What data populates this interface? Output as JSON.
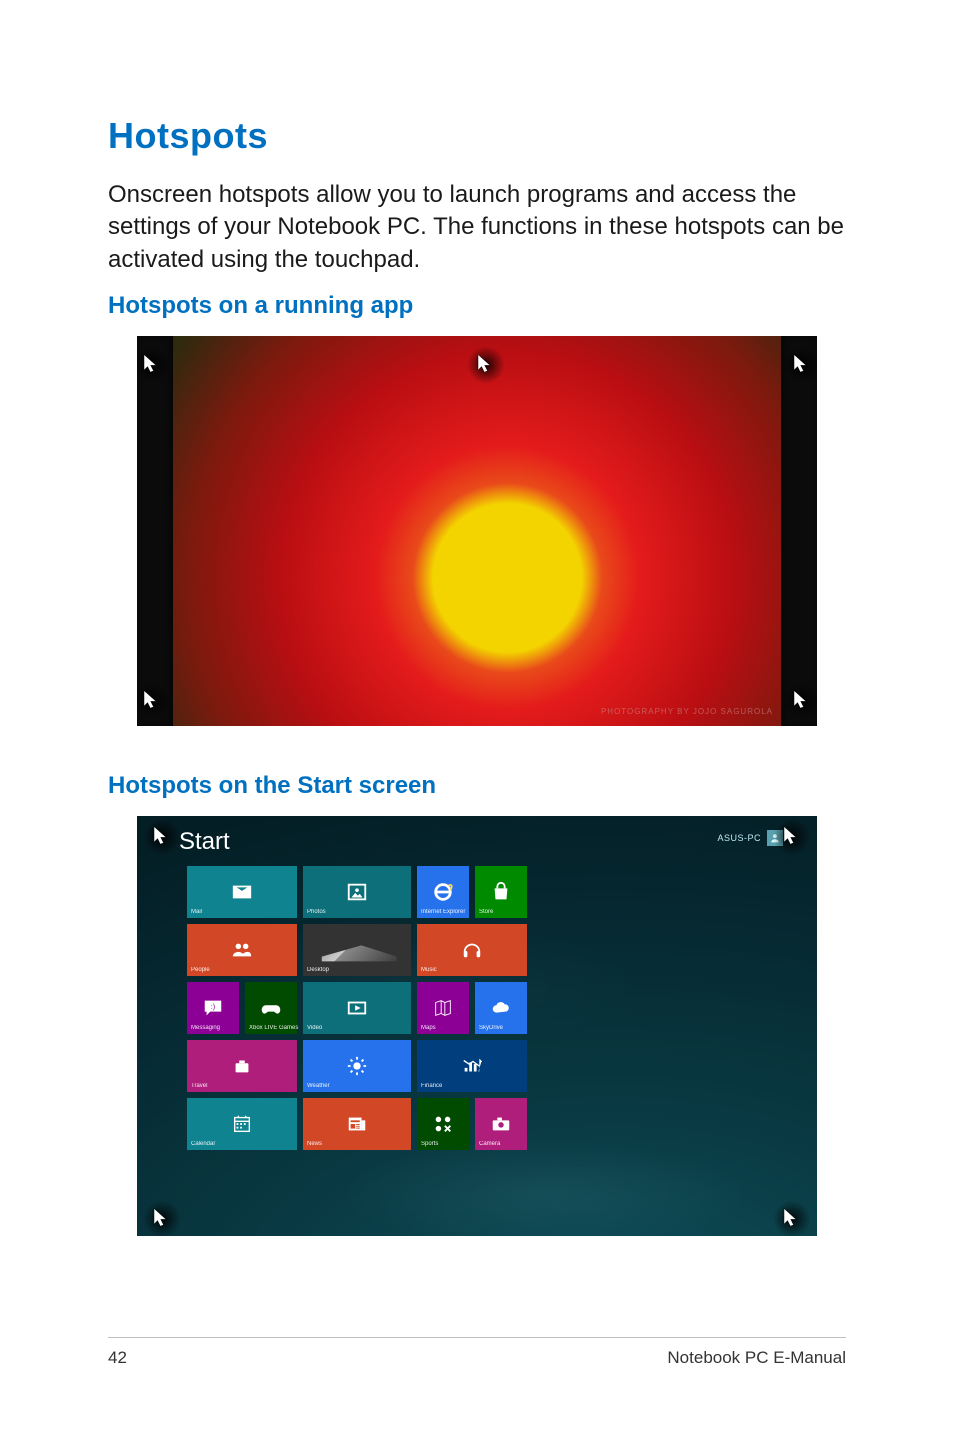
{
  "page": {
    "number": "42",
    "footer": "Notebook PC E-Manual"
  },
  "headings": {
    "title": "Hotspots",
    "sub_running": "Hotspots on a running app",
    "sub_start": "Hotspots on the Start screen"
  },
  "body": {
    "intro": "Onscreen hotspots allow you to launch programs and access the settings of your Notebook PC. The functions in these hotspots can be activated using the touchpad."
  },
  "running_app": {
    "photo_credit": "Photography by Jojo Sagurola"
  },
  "start_screen": {
    "title": "Start",
    "user": "ASUS-PC",
    "tiles": [
      {
        "id": "mail",
        "label": "Mail",
        "icon": "mail",
        "color": "c-teal",
        "wide": true
      },
      {
        "id": "photos",
        "label": "Photos",
        "icon": "photo",
        "color": "c-teal2",
        "wide": false,
        "col": 3
      },
      {
        "id": "ie",
        "label": "Internet Explorer",
        "icon": "ie",
        "color": "c-blue",
        "wide": false
      },
      {
        "id": "store",
        "label": "Store",
        "icon": "store",
        "color": "c-green",
        "wide": false
      },
      {
        "id": "people",
        "label": "People",
        "icon": "people",
        "color": "c-orange",
        "wide": true
      },
      {
        "id": "desktop",
        "label": "Desktop",
        "icon": "desktop",
        "color": "c-gray",
        "wide": false,
        "col": 3
      },
      {
        "id": "music",
        "label": "Music",
        "icon": "music",
        "color": "c-orange",
        "wide": true,
        "colstart": 4
      },
      {
        "id": "msg",
        "label": "Messaging",
        "icon": "chat",
        "color": "c-purple",
        "wide": false
      },
      {
        "id": "games",
        "label": "Xbox LIVE Games",
        "icon": "games",
        "color": "c-dgreen",
        "wide": false
      },
      {
        "id": "video",
        "label": "Video",
        "icon": "video",
        "color": "c-teal2",
        "wide": false,
        "col": 3
      },
      {
        "id": "maps",
        "label": "Maps",
        "icon": "maps",
        "color": "c-purple",
        "wide": false
      },
      {
        "id": "skydrive",
        "label": "SkyDrive",
        "icon": "cloud",
        "color": "c-blue",
        "wide": false
      },
      {
        "id": "travel",
        "label": "Travel",
        "icon": "travel",
        "color": "c-magenta",
        "wide": true
      },
      {
        "id": "weather",
        "label": "Weather",
        "icon": "weather",
        "color": "c-blue",
        "wide": false,
        "col": 3
      },
      {
        "id": "finance",
        "label": "Finance",
        "icon": "finance",
        "color": "c-dblue",
        "wide": true,
        "colstart": 4
      },
      {
        "id": "calendar",
        "label": "Calendar",
        "icon": "calendar",
        "color": "c-teal",
        "wide": true
      },
      {
        "id": "news",
        "label": "News",
        "icon": "news",
        "color": "c-orange",
        "wide": false,
        "col": 3
      },
      {
        "id": "sports",
        "label": "Sports",
        "icon": "sports",
        "color": "c-dgreen",
        "wide": false
      },
      {
        "id": "camera",
        "label": "Camera",
        "icon": "camera",
        "color": "c-magenta",
        "wide": false
      }
    ]
  }
}
